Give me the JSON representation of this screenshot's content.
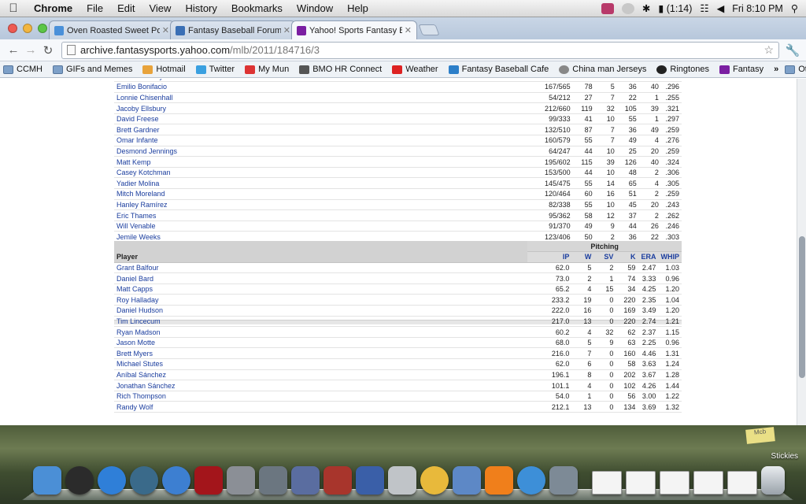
{
  "menubar": {
    "app_name": "Chrome",
    "menus": [
      "File",
      "Edit",
      "View",
      "History",
      "Bookmarks",
      "Window",
      "Help"
    ],
    "battery": "(1:14)",
    "clock": "Fri 8:10 PM"
  },
  "tabs": [
    {
      "title": "Oven Roasted Sweet Potatoe",
      "color": "#4a90d9"
    },
    {
      "title": "Fantasy Baseball Forums – F",
      "color": "#3a6fb5"
    },
    {
      "title": "Yahoo! Sports Fantasy Baseb",
      "color": "#7b1fa2"
    }
  ],
  "url": {
    "host": "archive.fantasysports.yahoo.com",
    "path": "/mlb/2011/184716/3"
  },
  "bookmarks": [
    {
      "label": "CCMH",
      "folder": true
    },
    {
      "label": "GIFs and Memes",
      "folder": true
    },
    {
      "label": "Hotmail",
      "color": "#e8a33b"
    },
    {
      "label": "Twitter",
      "color": "#3aa0e0"
    },
    {
      "label": "My Mun",
      "color": "#d33"
    },
    {
      "label": "BMO HR Connect",
      "color": "#555"
    },
    {
      "label": "Weather",
      "color": "#d22"
    },
    {
      "label": "Fantasy Baseball Cafe",
      "color": "#2c7fc9"
    },
    {
      "label": "China man Jerseys",
      "color": "#888"
    },
    {
      "label": "Ringtones",
      "color": "#222"
    },
    {
      "label": "Fantasy",
      "color": "#7b1fa2"
    }
  ],
  "bookmarks_more": "»",
  "other_bookmarks": "Other Bookmarks",
  "batting_rows": [
    {
      "player": "Darwin Barney",
      "hab": "146/529",
      "r": "66",
      "hr": "2",
      "rbi": "43",
      "sb": "9",
      "avg": ".276"
    },
    {
      "player": "Emilio Bonifacio",
      "hab": "167/565",
      "r": "78",
      "hr": "5",
      "rbi": "36",
      "sb": "40",
      "avg": ".296"
    },
    {
      "player": "Lonnie Chisenhall",
      "hab": "54/212",
      "r": "27",
      "hr": "7",
      "rbi": "22",
      "sb": "1",
      "avg": ".255"
    },
    {
      "player": "Jacoby Ellsbury",
      "hab": "212/660",
      "r": "119",
      "hr": "32",
      "rbi": "105",
      "sb": "39",
      "avg": ".321"
    },
    {
      "player": "David Freese",
      "hab": "99/333",
      "r": "41",
      "hr": "10",
      "rbi": "55",
      "sb": "1",
      "avg": ".297"
    },
    {
      "player": "Brett Gardner",
      "hab": "132/510",
      "r": "87",
      "hr": "7",
      "rbi": "36",
      "sb": "49",
      "avg": ".259"
    },
    {
      "player": "Omar Infante",
      "hab": "160/579",
      "r": "55",
      "hr": "7",
      "rbi": "49",
      "sb": "4",
      "avg": ".276"
    },
    {
      "player": "Desmond Jennings",
      "hab": "64/247",
      "r": "44",
      "hr": "10",
      "rbi": "25",
      "sb": "20",
      "avg": ".259"
    },
    {
      "player": "Matt Kemp",
      "hab": "195/602",
      "r": "115",
      "hr": "39",
      "rbi": "126",
      "sb": "40",
      "avg": ".324"
    },
    {
      "player": "Casey Kotchman",
      "hab": "153/500",
      "r": "44",
      "hr": "10",
      "rbi": "48",
      "sb": "2",
      "avg": ".306"
    },
    {
      "player": "Yadier Molina",
      "hab": "145/475",
      "r": "55",
      "hr": "14",
      "rbi": "65",
      "sb": "4",
      "avg": ".305"
    },
    {
      "player": "Mitch Moreland",
      "hab": "120/464",
      "r": "60",
      "hr": "16",
      "rbi": "51",
      "sb": "2",
      "avg": ".259"
    },
    {
      "player": "Hanley Ramírez",
      "hab": "82/338",
      "r": "55",
      "hr": "10",
      "rbi": "45",
      "sb": "20",
      "avg": ".243"
    },
    {
      "player": "Eric Thames",
      "hab": "95/362",
      "r": "58",
      "hr": "12",
      "rbi": "37",
      "sb": "2",
      "avg": ".262"
    },
    {
      "player": "Will Venable",
      "hab": "91/370",
      "r": "49",
      "hr": "9",
      "rbi": "44",
      "sb": "26",
      "avg": ".246"
    },
    {
      "player": "Jemile Weeks",
      "hab": "123/406",
      "r": "50",
      "hr": "2",
      "rbi": "36",
      "sb": "22",
      "avg": ".303"
    }
  ],
  "pitching": {
    "group_label": "Pitching",
    "player_header": "Player",
    "columns": {
      "ip": "IP",
      "w": "W",
      "sv": "SV",
      "k": "K",
      "era": "ERA",
      "whip": "WHIP"
    },
    "rows": [
      {
        "player": "Grant Balfour",
        "ip": "62.0",
        "w": "5",
        "sv": "2",
        "k": "59",
        "era": "2.47",
        "whip": "1.03"
      },
      {
        "player": "Daniel Bard",
        "ip": "73.0",
        "w": "2",
        "sv": "1",
        "k": "74",
        "era": "3.33",
        "whip": "0.96"
      },
      {
        "player": "Matt Capps",
        "ip": "65.2",
        "w": "4",
        "sv": "15",
        "k": "34",
        "era": "4.25",
        "whip": "1.20"
      },
      {
        "player": "Roy Halladay",
        "ip": "233.2",
        "w": "19",
        "sv": "0",
        "k": "220",
        "era": "2.35",
        "whip": "1.04"
      },
      {
        "player": "Daniel Hudson",
        "ip": "222.0",
        "w": "16",
        "sv": "0",
        "k": "169",
        "era": "3.49",
        "whip": "1.20"
      },
      {
        "player": "Tim Lincecum",
        "ip": "217.0",
        "w": "13",
        "sv": "0",
        "k": "220",
        "era": "2.74",
        "whip": "1.21"
      },
      {
        "player": "Ryan Madson",
        "ip": "60.2",
        "w": "4",
        "sv": "32",
        "k": "62",
        "era": "2.37",
        "whip": "1.15"
      },
      {
        "player": "Jason Motte",
        "ip": "68.0",
        "w": "5",
        "sv": "9",
        "k": "63",
        "era": "2.25",
        "whip": "0.96"
      },
      {
        "player": "Brett Myers",
        "ip": "216.0",
        "w": "7",
        "sv": "0",
        "k": "160",
        "era": "4.46",
        "whip": "1.31"
      },
      {
        "player": "Michael Stutes",
        "ip": "62.0",
        "w": "6",
        "sv": "0",
        "k": "58",
        "era": "3.63",
        "whip": "1.24"
      },
      {
        "player": "Aníbal Sánchez",
        "ip": "196.1",
        "w": "8",
        "sv": "0",
        "k": "202",
        "era": "3.67",
        "whip": "1.28"
      },
      {
        "player": "Jonathan Sánchez",
        "ip": "101.1",
        "w": "4",
        "sv": "0",
        "k": "102",
        "era": "4.26",
        "whip": "1.44"
      },
      {
        "player": "Rich Thompson",
        "ip": "54.0",
        "w": "1",
        "sv": "0",
        "k": "56",
        "era": "3.00",
        "whip": "1.22"
      },
      {
        "player": "Randy Wolf",
        "ip": "212.1",
        "w": "13",
        "sv": "0",
        "k": "134",
        "era": "3.69",
        "whip": "1.32"
      }
    ]
  },
  "desktop": {
    "sticky_note": "Mcb",
    "stickies_label": "Stickies"
  },
  "dock_icons": [
    {
      "name": "finder-icon",
      "color": "#4b8fd6",
      "round": false
    },
    {
      "name": "dashboard-icon",
      "color": "#2b2b2b",
      "round": true
    },
    {
      "name": "app-store-icon",
      "color": "#2f7fd8",
      "round": true
    },
    {
      "name": "time-machine-icon",
      "color": "#3a6a8a",
      "round": true
    },
    {
      "name": "itunes-icon",
      "color": "#3d7fd1",
      "round": true
    },
    {
      "name": "photo-booth-icon",
      "color": "#a3151b",
      "round": false
    },
    {
      "name": "system-preferences-icon",
      "color": "#8b8f96",
      "round": false
    },
    {
      "name": "facetime-icon",
      "color": "#6b7680",
      "round": false
    },
    {
      "name": "preview-icon",
      "color": "#5a6da0",
      "round": false
    },
    {
      "name": "dictionary-icon",
      "color": "#a8352c",
      "round": false
    },
    {
      "name": "grapher-icon",
      "color": "#3a5fa8",
      "round": false
    },
    {
      "name": "automator-icon",
      "color": "#c0c4c8",
      "round": false
    },
    {
      "name": "chrome-icon",
      "color": "#e8b93b",
      "round": true
    },
    {
      "name": "keynote-icon",
      "color": "#5d88c6",
      "round": false
    },
    {
      "name": "vlc-icon",
      "color": "#f07f1b",
      "round": false
    },
    {
      "name": "safari-icon",
      "color": "#3d8fd8",
      "round": true
    },
    {
      "name": "image-capture-icon",
      "color": "#7d8a96",
      "round": false
    }
  ],
  "dock_docs": [
    {
      "name": "document-thumbnail-icon"
    },
    {
      "name": "document-thumbnail-icon"
    },
    {
      "name": "document-thumbnail-icon"
    },
    {
      "name": "document-thumbnail-icon"
    },
    {
      "name": "document-thumbnail-icon"
    }
  ]
}
